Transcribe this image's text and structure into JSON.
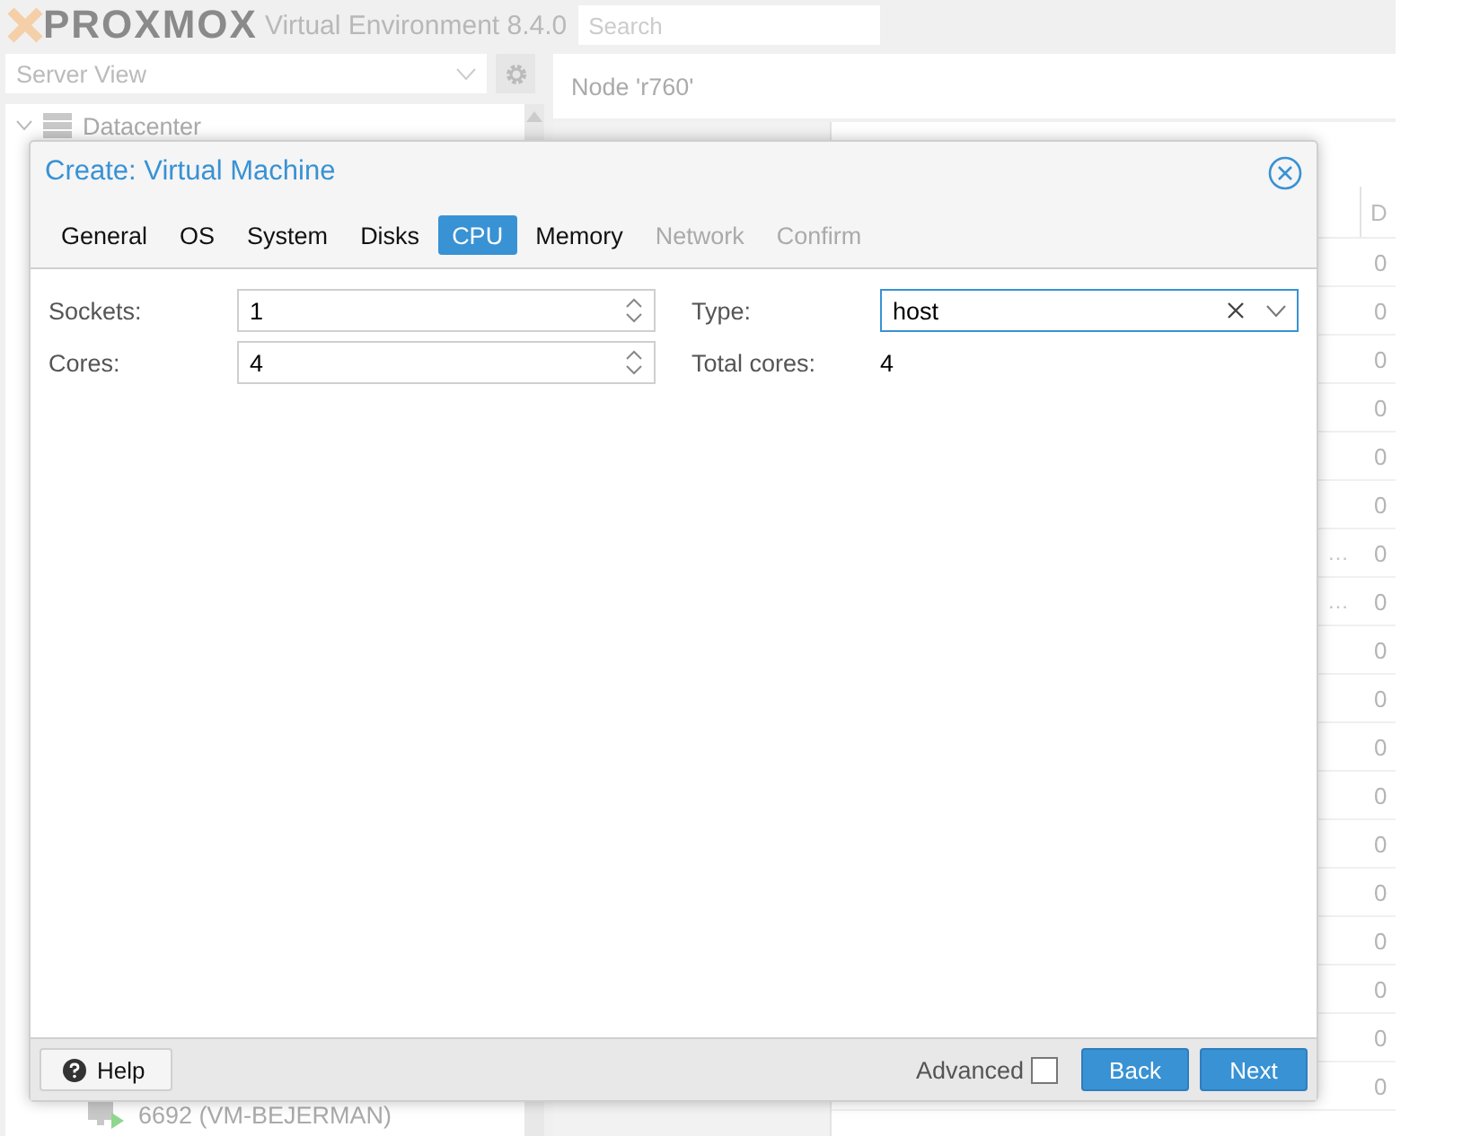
{
  "header": {
    "logo": "PROXMOX",
    "version": "Virtual Environment 8.4.0",
    "search": {
      "placeholder": "Search"
    }
  },
  "sidebar": {
    "view_select": "Server View",
    "tree": [
      {
        "label": "Datacenter",
        "expanded": true,
        "kind": "datacenter",
        "children": [
          {
            "label": "6692 (VM-BEJERMAN)",
            "kind": "vm"
          }
        ]
      }
    ]
  },
  "content": {
    "title": "Node 'r760'",
    "table": {
      "column_1": "D",
      "rows": [
        {
          "column_2": "0"
        },
        {
          "column_2": "0"
        },
        {
          "column_2": "0"
        },
        {
          "column_2": "0"
        },
        {
          "column_2": "0"
        },
        {
          "column_2": "0"
        },
        {
          "column_1": "…",
          "column_2": "0"
        },
        {
          "column_1": "…",
          "column_2": "0"
        },
        {
          "column_2": "0"
        },
        {
          "column_2": "0"
        },
        {
          "column_2": "0"
        },
        {
          "column_2": "0"
        },
        {
          "column_2": "0"
        },
        {
          "column_2": "0"
        },
        {
          "column_2": "0"
        },
        {
          "column_2": "0"
        },
        {
          "column_2": "0"
        },
        {
          "column_2": "0"
        }
      ]
    }
  },
  "dialog": {
    "title": "Create: Virtual Machine",
    "tabs": [
      {
        "label": "General",
        "selected": false,
        "disabled": false
      },
      {
        "label": "OS",
        "selected": false,
        "disabled": false
      },
      {
        "label": "System",
        "selected": false,
        "disabled": false
      },
      {
        "label": "Disks",
        "selected": false,
        "disabled": false
      },
      {
        "label": "CPU",
        "selected": true,
        "disabled": false
      },
      {
        "label": "Memory",
        "selected": false,
        "disabled": false
      },
      {
        "label": "Network",
        "selected": false,
        "disabled": true
      },
      {
        "label": "Confirm",
        "selected": false,
        "disabled": true
      }
    ],
    "left_fields": [
      {
        "label": "Sockets:",
        "value": "1",
        "kind": "spinner"
      },
      {
        "label": "Cores:",
        "value": "4",
        "kind": "spinner"
      }
    ],
    "right_fields": [
      {
        "label": "Type:",
        "value": "host",
        "kind": "combo"
      },
      {
        "label": "Total cores:",
        "value": "4",
        "kind": "display"
      }
    ],
    "footer": {
      "help": "Help",
      "advanced": {
        "label": "Advanced",
        "checked": false
      },
      "buttons": [
        "Back",
        "Next"
      ]
    }
  }
}
